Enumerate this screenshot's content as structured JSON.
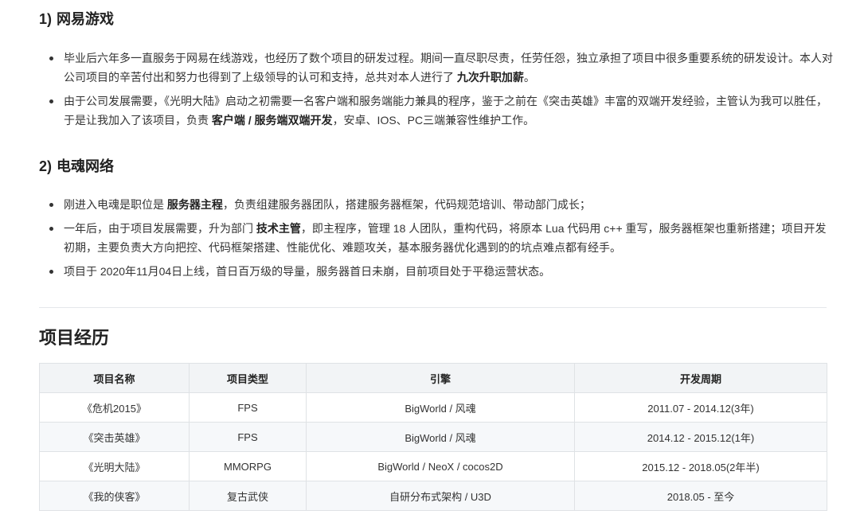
{
  "netease": {
    "number": "1)",
    "title": "网易游戏",
    "items": [
      {
        "pre": "毕业后六年多一直服务于网易在线游戏，也经历了数个项目的研发过程。期间一直尽职尽责，任劳任怨，独立承担了项目中很多重要系统的研发设计。本人对公司项目的辛苦付出和努力也得到了上级领导的认可和支持，总共对本人进行了 ",
        "bold": "九次升职加薪",
        "post": "。"
      },
      {
        "pre": "由于公司发展需要，《光明大陆》启动之初需要一名客户端和服务端能力兼具的程序，鉴于之前在《突击英雄》丰富的双端开发经验，主管认为我可以胜任，于是让我加入了该项目，负责 ",
        "bold": "客户端 / 服务端双端开发",
        "post": "，安卓、IOS、PC三端兼容性维护工作。"
      }
    ]
  },
  "dianhun": {
    "number": "2)",
    "title": "电魂网络",
    "items": [
      {
        "pre": "刚进入电魂是职位是 ",
        "bold": "服务器主程",
        "post": "，负责组建服务器团队，搭建服务器框架，代码规范培训、带动部门成长；"
      },
      {
        "pre": "一年后，由于项目发展需要，升为部门 ",
        "bold": "技术主管",
        "post": "，即主程序，管理 18 人团队，重构代码，将原本 Lua 代码用 c++ 重写，服务器框架也重新搭建；项目开发初期，主要负责大方向把控、代码框架搭建、性能优化、难题攻关，基本服务器优化遇到的的坑点难点都有经手。"
      },
      {
        "pre": "项目于 2020年11月04日上线，首日百万级的导量，服务器首日未崩，目前项目处于平稳运营状态。",
        "bold": "",
        "post": ""
      }
    ]
  },
  "projects": {
    "title": "项目经历",
    "headers": [
      "项目名称",
      "项目类型",
      "引擎",
      "开发周期"
    ],
    "rows": [
      [
        "《危机2015》",
        "FPS",
        "BigWorld / 风魂",
        "2011.07 - 2014.12(3年)"
      ],
      [
        "《突击英雄》",
        "FPS",
        "BigWorld / 风魂",
        "2014.12 - 2015.12(1年)"
      ],
      [
        "《光明大陆》",
        "MMORPG",
        "BigWorld / NeoX / cocos2D",
        "2015.12 - 2018.05(2年半)"
      ],
      [
        "《我的侠客》",
        "复古武侠",
        "自研分布式架构 / U3D",
        "2018.05 - 至今"
      ]
    ]
  }
}
